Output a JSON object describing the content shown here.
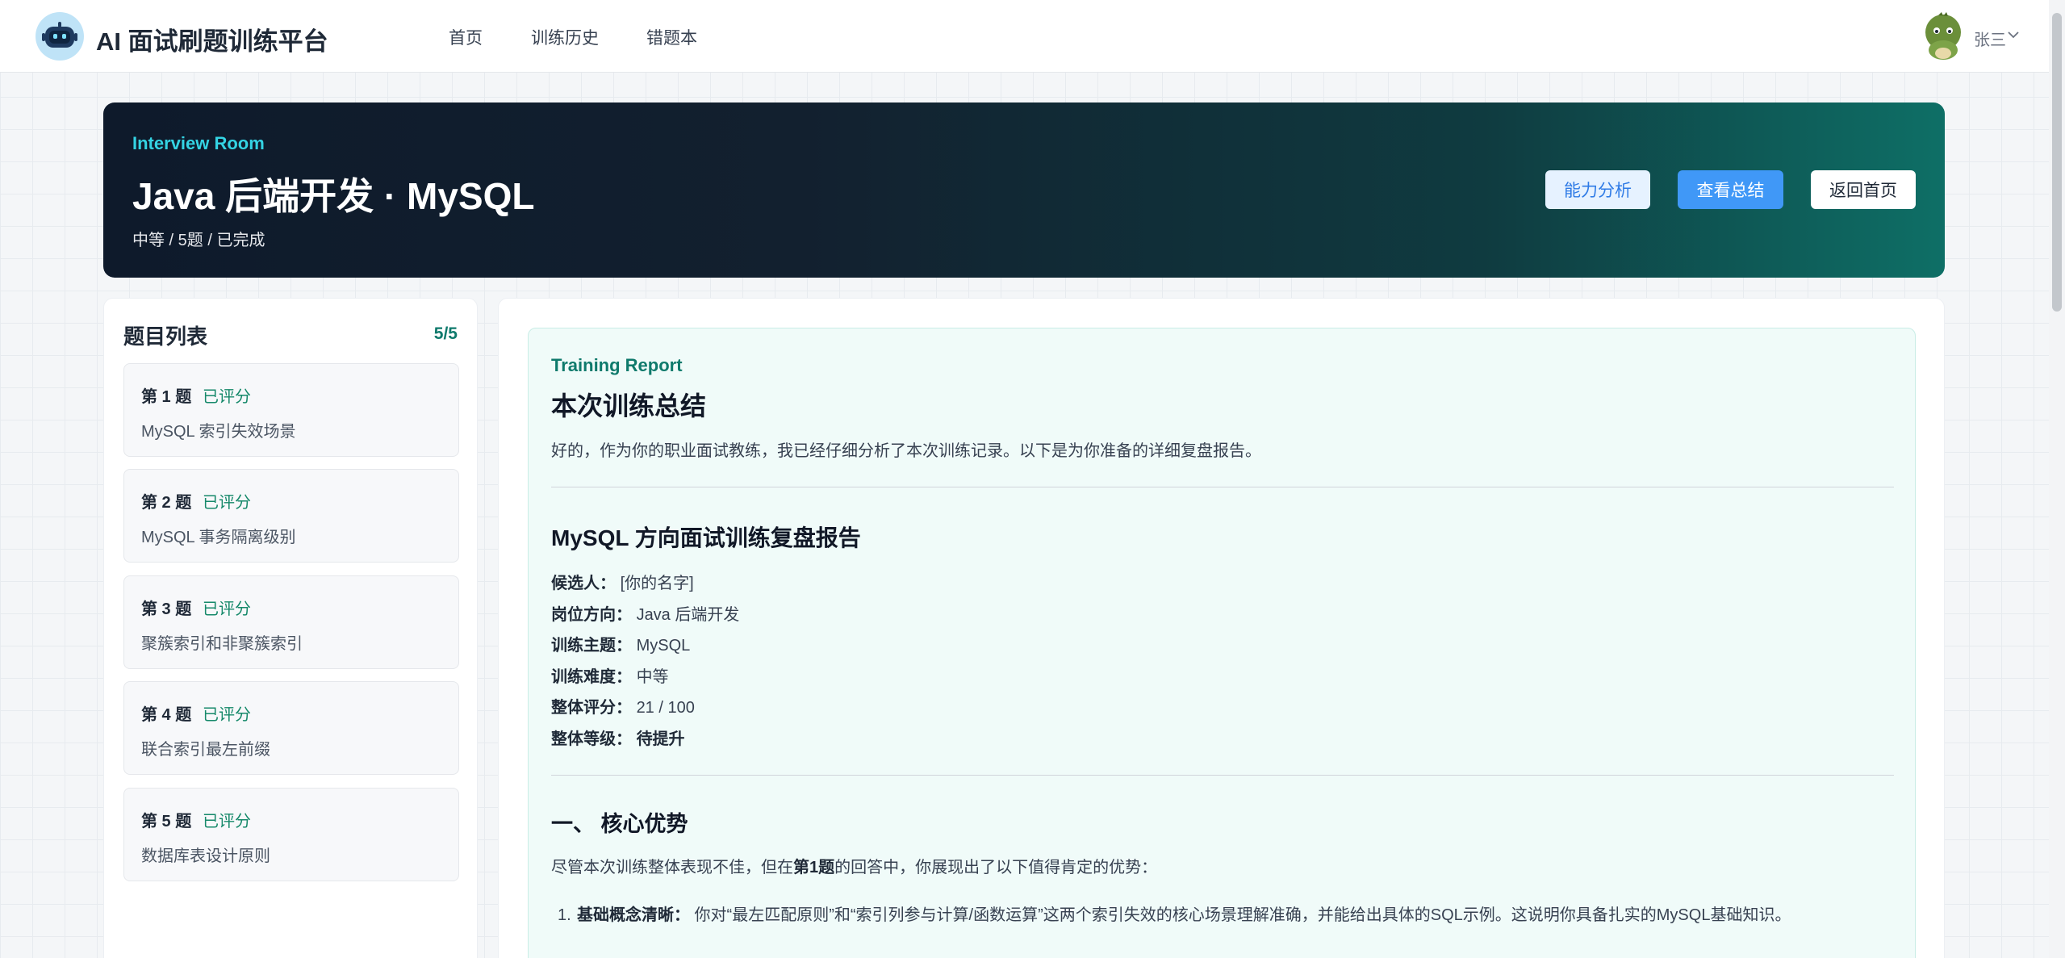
{
  "app": {
    "brand": "AI 面试刷题训练平台",
    "nav": [
      "首页",
      "训练历史",
      "错题本"
    ],
    "user": {
      "name": "张三"
    }
  },
  "hero": {
    "kicker": "Interview Room",
    "title": "Java 后端开发 · MySQL",
    "meta": "中等 / 5题 / 已完成",
    "buttons": {
      "analysis": "能力分析",
      "summary": "查看总结",
      "home": "返回首页"
    }
  },
  "question_list": {
    "title": "题目列表",
    "count": "5/5",
    "items": [
      {
        "no": "第 1 题",
        "status": "已评分",
        "title": "MySQL 索引失效场景"
      },
      {
        "no": "第 2 题",
        "status": "已评分",
        "title": "MySQL 事务隔离级别"
      },
      {
        "no": "第 3 题",
        "status": "已评分",
        "title": "聚簇索引和非聚簇索引"
      },
      {
        "no": "第 4 题",
        "status": "已评分",
        "title": "联合索引最左前缀"
      },
      {
        "no": "第 5 题",
        "status": "已评分",
        "title": "数据库表设计原则"
      }
    ]
  },
  "report": {
    "kicker": "Training Report",
    "title": "本次训练总结",
    "intro": "好的，作为你的职业面试教练，我已经仔细分析了本次训练记录。以下是为你准备的详细复盘报告。",
    "heading": "MySQL 方向面试训练复盘报告",
    "info": [
      {
        "label": "候选人：",
        "value": "[你的名字]"
      },
      {
        "label": "岗位方向：",
        "value": "Java 后端开发"
      },
      {
        "label": "训练主题：",
        "value": "MySQL"
      },
      {
        "label": "训练难度：",
        "value": "中等"
      },
      {
        "label": "整体评分：",
        "value": "21 / 100"
      },
      {
        "label": "整体等级：",
        "value": "待提升"
      }
    ],
    "section1": {
      "title": "一、 核心优势",
      "para_before": "尽管本次训练整体表现不佳，但在",
      "para_bold": "第1题",
      "para_after": "的回答中，你展现出了以下值得肯定的优势：",
      "items": [
        {
          "num": "1.",
          "bold": "基础概念清晰：",
          "text": " 你对“最左匹配原则”和“索引列参与计算/函数运算”这两个索引失效的核心场景理解准确，并能给出具体的SQL示例。这说明你具备扎实的MySQL基础知识。"
        }
      ]
    }
  },
  "colors": {
    "accent_teal": "#0f7a6c",
    "primary_blue": "#4098f7",
    "hero_dark": "#0e1a2b",
    "hero_teal": "#0e6f66"
  },
  "icons": {
    "logo": "robot-icon",
    "avatar": "dinosaur-avatar",
    "user_menu": "chevron-down-icon"
  }
}
